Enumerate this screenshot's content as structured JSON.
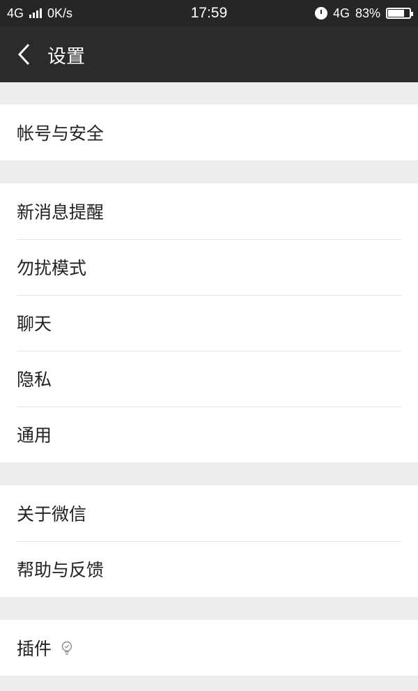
{
  "status_bar": {
    "network": "4G",
    "speed": "0K/s",
    "time": "17:59",
    "network_right": "4G",
    "battery_percent": "83%",
    "battery_level": 0.83
  },
  "nav": {
    "back_icon": "chevron-left-icon",
    "title": "设置"
  },
  "groups": [
    {
      "items": [
        "帐号与安全"
      ]
    },
    {
      "items": [
        "新消息提醒",
        "勿扰模式",
        "聊天",
        "隐私",
        "通用"
      ]
    },
    {
      "items": [
        "关于微信",
        "帮助与反馈"
      ]
    },
    {
      "items": [
        "插件"
      ],
      "plugin_icon": "bulb-icon"
    }
  ]
}
